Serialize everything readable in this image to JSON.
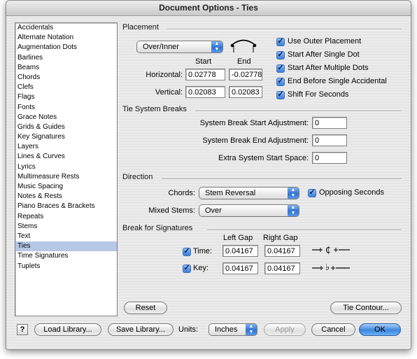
{
  "window": {
    "title": "Document Options - Ties"
  },
  "sidebar": {
    "items": [
      {
        "label": "Accidentals",
        "selected": false
      },
      {
        "label": "Alternate Notation",
        "selected": false
      },
      {
        "label": "Augmentation Dots",
        "selected": false
      },
      {
        "label": "Barlines",
        "selected": false
      },
      {
        "label": "Beams",
        "selected": false
      },
      {
        "label": "Chords",
        "selected": false
      },
      {
        "label": "Clefs",
        "selected": false
      },
      {
        "label": "Flags",
        "selected": false
      },
      {
        "label": "Fonts",
        "selected": false
      },
      {
        "label": "Grace Notes",
        "selected": false
      },
      {
        "label": "Grids & Guides",
        "selected": false
      },
      {
        "label": "Key Signatures",
        "selected": false
      },
      {
        "label": "Layers",
        "selected": false
      },
      {
        "label": "Lines & Curves",
        "selected": false
      },
      {
        "label": "Lyrics",
        "selected": false
      },
      {
        "label": "Multimeasure Rests",
        "selected": false
      },
      {
        "label": "Music Spacing",
        "selected": false
      },
      {
        "label": "Notes & Rests",
        "selected": false
      },
      {
        "label": "Piano Braces & Brackets",
        "selected": false
      },
      {
        "label": "Repeats",
        "selected": false
      },
      {
        "label": "Stems",
        "selected": false
      },
      {
        "label": "Text",
        "selected": false
      },
      {
        "label": "Ties",
        "selected": true
      },
      {
        "label": "Time Signatures",
        "selected": false
      },
      {
        "label": "Tuplets",
        "selected": false
      }
    ]
  },
  "placement": {
    "title": "Placement",
    "popup_value": "Over/Inner",
    "start_header": "Start",
    "end_header": "End",
    "horizontal_label": "Horizontal:",
    "vertical_label": "Vertical:",
    "horizontal_start": "0.02778",
    "horizontal_end": "-0.02778",
    "vertical_start": "0.02083",
    "vertical_end": "0.02083",
    "checkboxes": [
      {
        "label": "Use Outer Placement",
        "checked": true
      },
      {
        "label": "Start After Single Dot",
        "checked": true
      },
      {
        "label": "Start After Multiple Dots",
        "checked": true
      },
      {
        "label": "End Before Single Accidental",
        "checked": true
      },
      {
        "label": "Shift For Seconds",
        "checked": true
      }
    ]
  },
  "system_breaks": {
    "title": "Tie System Breaks",
    "start_label": "System Break Start Adjustment:",
    "start_value": "0",
    "end_label": "System Break End Adjustment:",
    "end_value": "0",
    "extra_label": "Extra System Start Space:",
    "extra_value": "0"
  },
  "direction": {
    "title": "Direction",
    "chords_label": "Chords:",
    "chords_value": "Stem Reversal",
    "opposing_label": "Opposing Seconds",
    "opposing_checked": true,
    "mixed_label": "Mixed Stems:",
    "mixed_value": "Over"
  },
  "signatures": {
    "title": "Break for Signatures",
    "left_gap_header": "Left Gap",
    "right_gap_header": "Right Gap",
    "time_label": "Time:",
    "time_checked": true,
    "time_left": "0.04167",
    "time_right": "0.04167",
    "key_label": "Key:",
    "key_checked": true,
    "key_left": "0.04167",
    "key_right": "0.04167"
  },
  "buttons": {
    "reset": "Reset",
    "tie_contour": "Tie Contour...",
    "help": "?",
    "load_library": "Load Library...",
    "save_library": "Save Library...",
    "units_label": "Units:",
    "units_value": "Inches",
    "apply": "Apply",
    "cancel": "Cancel",
    "ok": "OK"
  }
}
